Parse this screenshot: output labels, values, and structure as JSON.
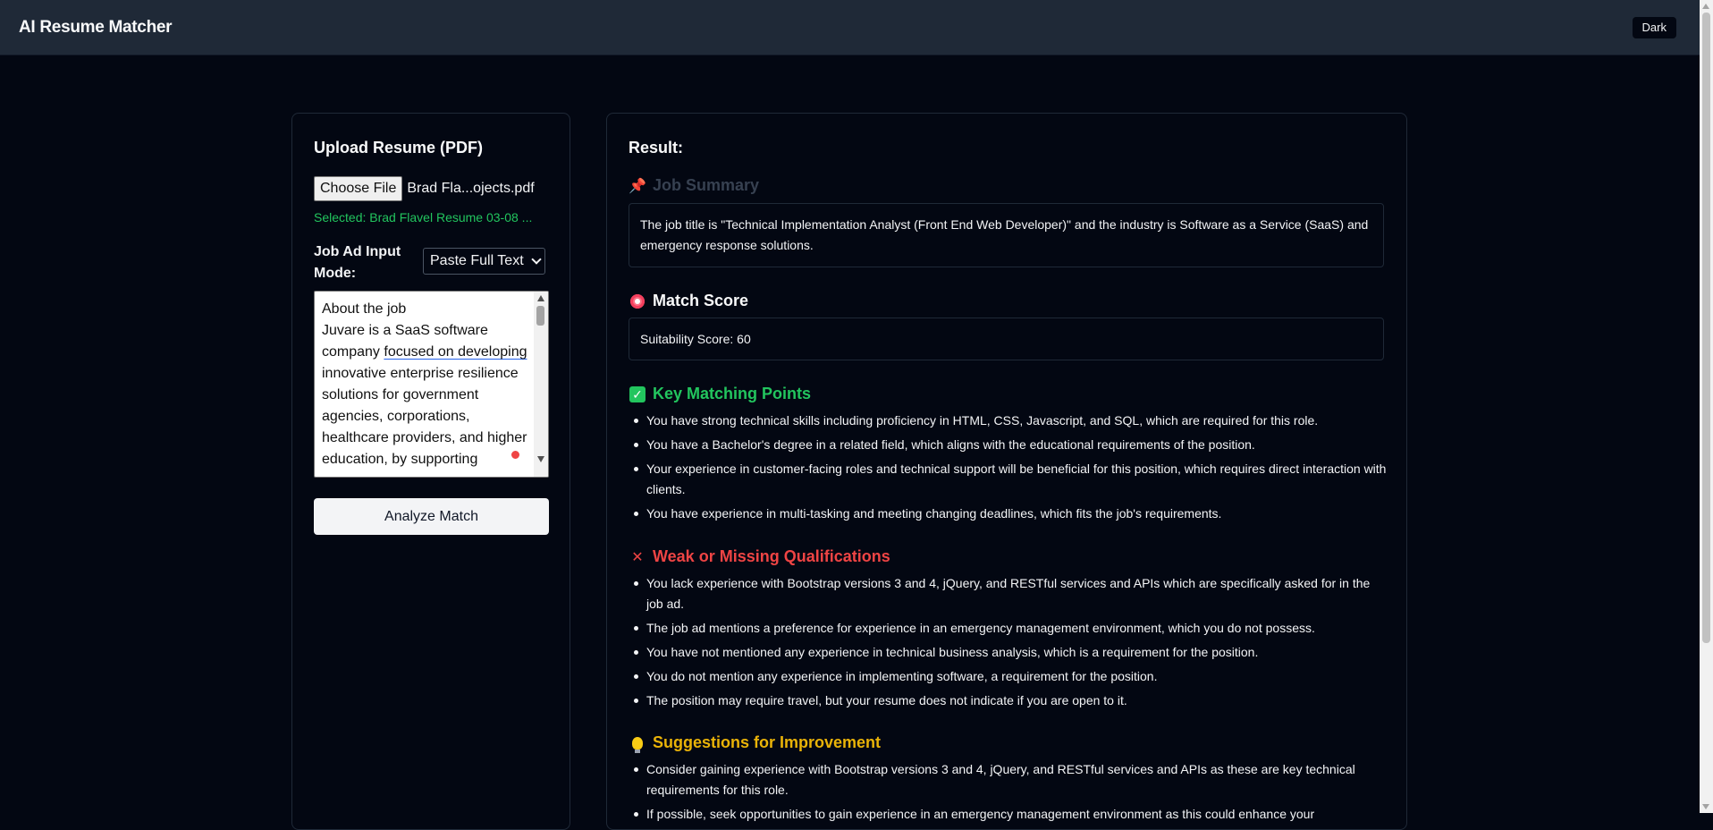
{
  "app": {
    "title": "AI Resume Matcher",
    "theme_toggle": "Dark"
  },
  "upload": {
    "heading": "Upload Resume (PDF)",
    "choose_label": "Choose File",
    "file_name": "Brad Fla...ojects.pdf",
    "selected_text": "Selected: Brad Flavel Resume 03-08 ..."
  },
  "job_ad": {
    "mode_label": "Job Ad Input Mode:",
    "mode_value": "Paste Full Text",
    "text_before": "About the job\nJuvare is a SaaS software company ",
    "text_underlined": "focused on developing",
    "text_after": " innovative enterprise resilience solutions for government agencies, corporations, healthcare providers, and higher education, by supporting"
  },
  "analyze_label": "Analyze Match",
  "result": {
    "heading": "Result:",
    "job_summary": {
      "icon": "pushpin-icon",
      "heading": "Job Summary",
      "text": "The job title is \"Technical Implementation Analyst (Front End Web Developer)\" and the industry is Software as a Service (SaaS) and emergency response solutions."
    },
    "match_score": {
      "icon": "target-icon",
      "heading": "Match Score",
      "text": "Suitability Score: 60"
    },
    "key_matching": {
      "icon": "check-icon",
      "heading": "Key Matching Points",
      "color": "#22c55e",
      "items": [
        "You have strong technical skills including proficiency in HTML, CSS, Javascript, and SQL, which are required for this role.",
        "You have a Bachelor's degree in a related field, which aligns with the educational requirements of the position.",
        "Your experience in customer-facing roles and technical support will be beneficial for this position, which requires direct interaction with clients.",
        "You have experience in multi-tasking and meeting changing deadlines, which fits the job's requirements."
      ]
    },
    "weak_missing": {
      "icon": "cross-icon",
      "heading": "Weak or Missing Qualifications",
      "color": "#ef4444",
      "items": [
        "You lack experience with Bootstrap versions 3 and 4, jQuery, and RESTful services and APIs which are specifically asked for in the job ad.",
        "The job ad mentions a preference for experience in an emergency management environment, which you do not possess.",
        "You have not mentioned any experience in technical business analysis, which is a requirement for the position.",
        "You do not mention any experience in implementing software, a requirement for the position.",
        "The position may require travel, but your resume does not indicate if you are open to it."
      ]
    },
    "suggestions": {
      "icon": "lightbulb-icon",
      "heading": "Suggestions for Improvement",
      "color": "#eab308",
      "items": [
        "Consider gaining experience with Bootstrap versions 3 and 4, jQuery, and RESTful services and APIs as these are key technical requirements for this role.",
        "If possible, seek opportunities to gain experience in an emergency management environment as this could enhance your"
      ]
    }
  }
}
